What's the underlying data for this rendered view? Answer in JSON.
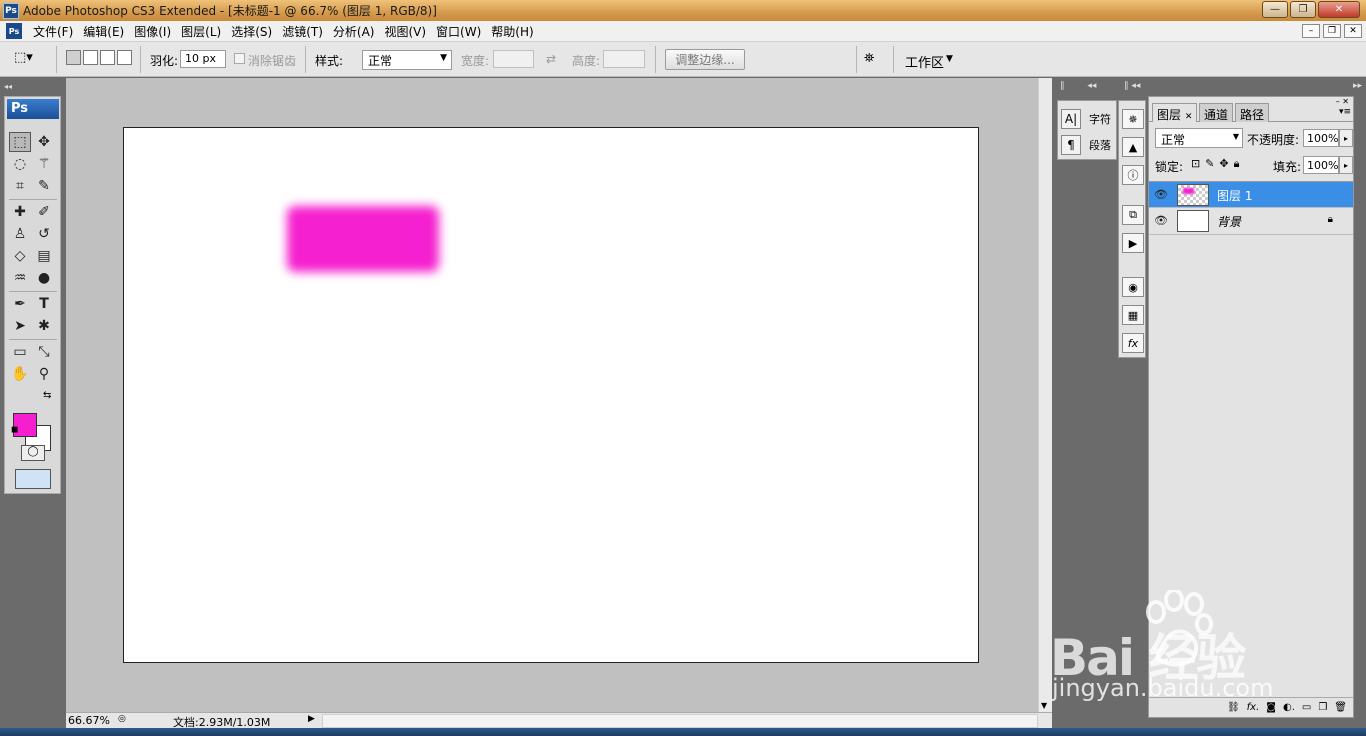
{
  "window": {
    "title": "Adobe Photoshop CS3 Extended - [未标题-1 @ 66.7% (图层 1, RGB/8)]",
    "app_badge": "Ps",
    "controls": [
      "—",
      "❐",
      "✕"
    ]
  },
  "menu": {
    "items": [
      "文件(F)",
      "编辑(E)",
      "图像(I)",
      "图层(L)",
      "选择(S)",
      "滤镜(T)",
      "分析(A)",
      "视图(V)",
      "窗口(W)",
      "帮助(H)"
    ],
    "doc_controls": [
      "–",
      "❐",
      "✕"
    ]
  },
  "options": {
    "feather_label": "羽化:",
    "feather_value": "10 px",
    "antialias_label": "消除锯齿",
    "style_label": "样式:",
    "style_value": "正常",
    "width_label": "宽度:",
    "height_label": "高度:",
    "refine_edge_button": "调整边缘...",
    "workspace_label": "工作区"
  },
  "toolbox": {
    "logo": "Ps",
    "foreground_color": "#f51fcf",
    "background_color": "#ffffff"
  },
  "canvas": {
    "shape_color": "#f520cf"
  },
  "status": {
    "zoom": "66.67%",
    "doc_info": "文档:2.93M/1.03M"
  },
  "panels": {
    "character_label": "字符",
    "paragraph_label": "段落",
    "layers": {
      "tabs": [
        "图层",
        "通道",
        "路径"
      ],
      "blend_mode": "正常",
      "opacity_label": "不透明度:",
      "opacity_value": "100%",
      "lock_label": "锁定:",
      "fill_label": "填充:",
      "fill_value": "100%",
      "rows": [
        {
          "name": "图层 1",
          "selected": true
        },
        {
          "name": "背景",
          "locked": true
        }
      ]
    }
  },
  "watermark": {
    "logo_text": "Bai  经验",
    "url": "jingyan.baidu.com"
  }
}
